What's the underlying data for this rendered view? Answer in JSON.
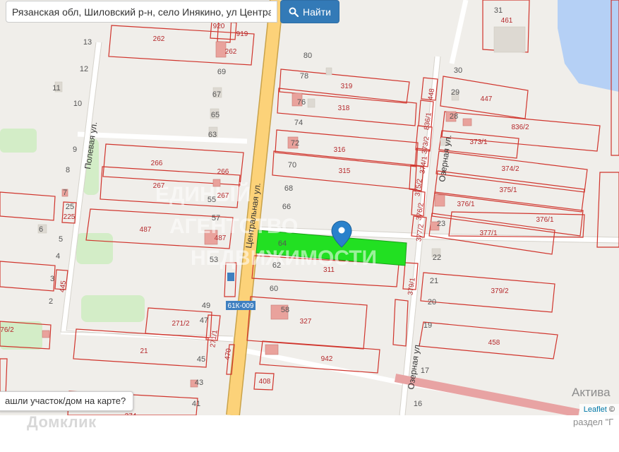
{
  "search": {
    "value": "Рязанская обл, Шиловский р-н, село Инякино, ул Центральная",
    "button_label": "Найти",
    "button_icon": "search-icon"
  },
  "colors": {
    "map_background": "#f0eeea",
    "parcel_outline": "#d0342c",
    "selected_parcel": "#22e022",
    "main_road": "#fcd279",
    "marker": "#2a81cb",
    "water": "#b5d0f5",
    "search_button": "#337ab7"
  },
  "map": {
    "streets": [
      "Центральная ул.",
      "Полевая ул.",
      "Озерная ул."
    ],
    "road_badge": "61К-009",
    "parcels": [
      "919",
      "262",
      "262",
      "920",
      "319",
      "318",
      "316",
      "315",
      "266",
      "266",
      "267",
      "267",
      "487",
      "487",
      "311",
      "327",
      "942",
      "408",
      "271/2",
      "271/1",
      "21",
      "470",
      "447",
      "836/2",
      "373/1",
      "374/2",
      "375/1",
      "376/1",
      "376/1",
      "377/1",
      "379/2",
      "458",
      "461",
      "448",
      "836/1",
      "373/2",
      "374/1",
      "375/2",
      "376/2",
      "377/2",
      "379/1",
      "225",
      "445",
      "76/2",
      "274"
    ],
    "house_numbers": [
      "31",
      "30",
      "29",
      "28",
      "80",
      "78",
      "76",
      "74",
      "72",
      "70",
      "69",
      "68",
      "67",
      "66",
      "65",
      "64",
      "63",
      "62",
      "60",
      "58",
      "57",
      "55",
      "53",
      "49",
      "47",
      "45",
      "43",
      "41",
      "13",
      "12",
      "11",
      "10",
      "9",
      "8",
      "7",
      "6",
      "5",
      "4",
      "3",
      "2",
      "25",
      "23",
      "22",
      "21",
      "20",
      "19",
      "17",
      "16"
    ],
    "attribution_link": "Leaflet",
    "attribution_text": "©",
    "footer_logo": "Домклик",
    "tooltip": "ашли участок/дом на карте?",
    "activate_title": "Актива",
    "activate_sub": "раздел \"Г"
  }
}
